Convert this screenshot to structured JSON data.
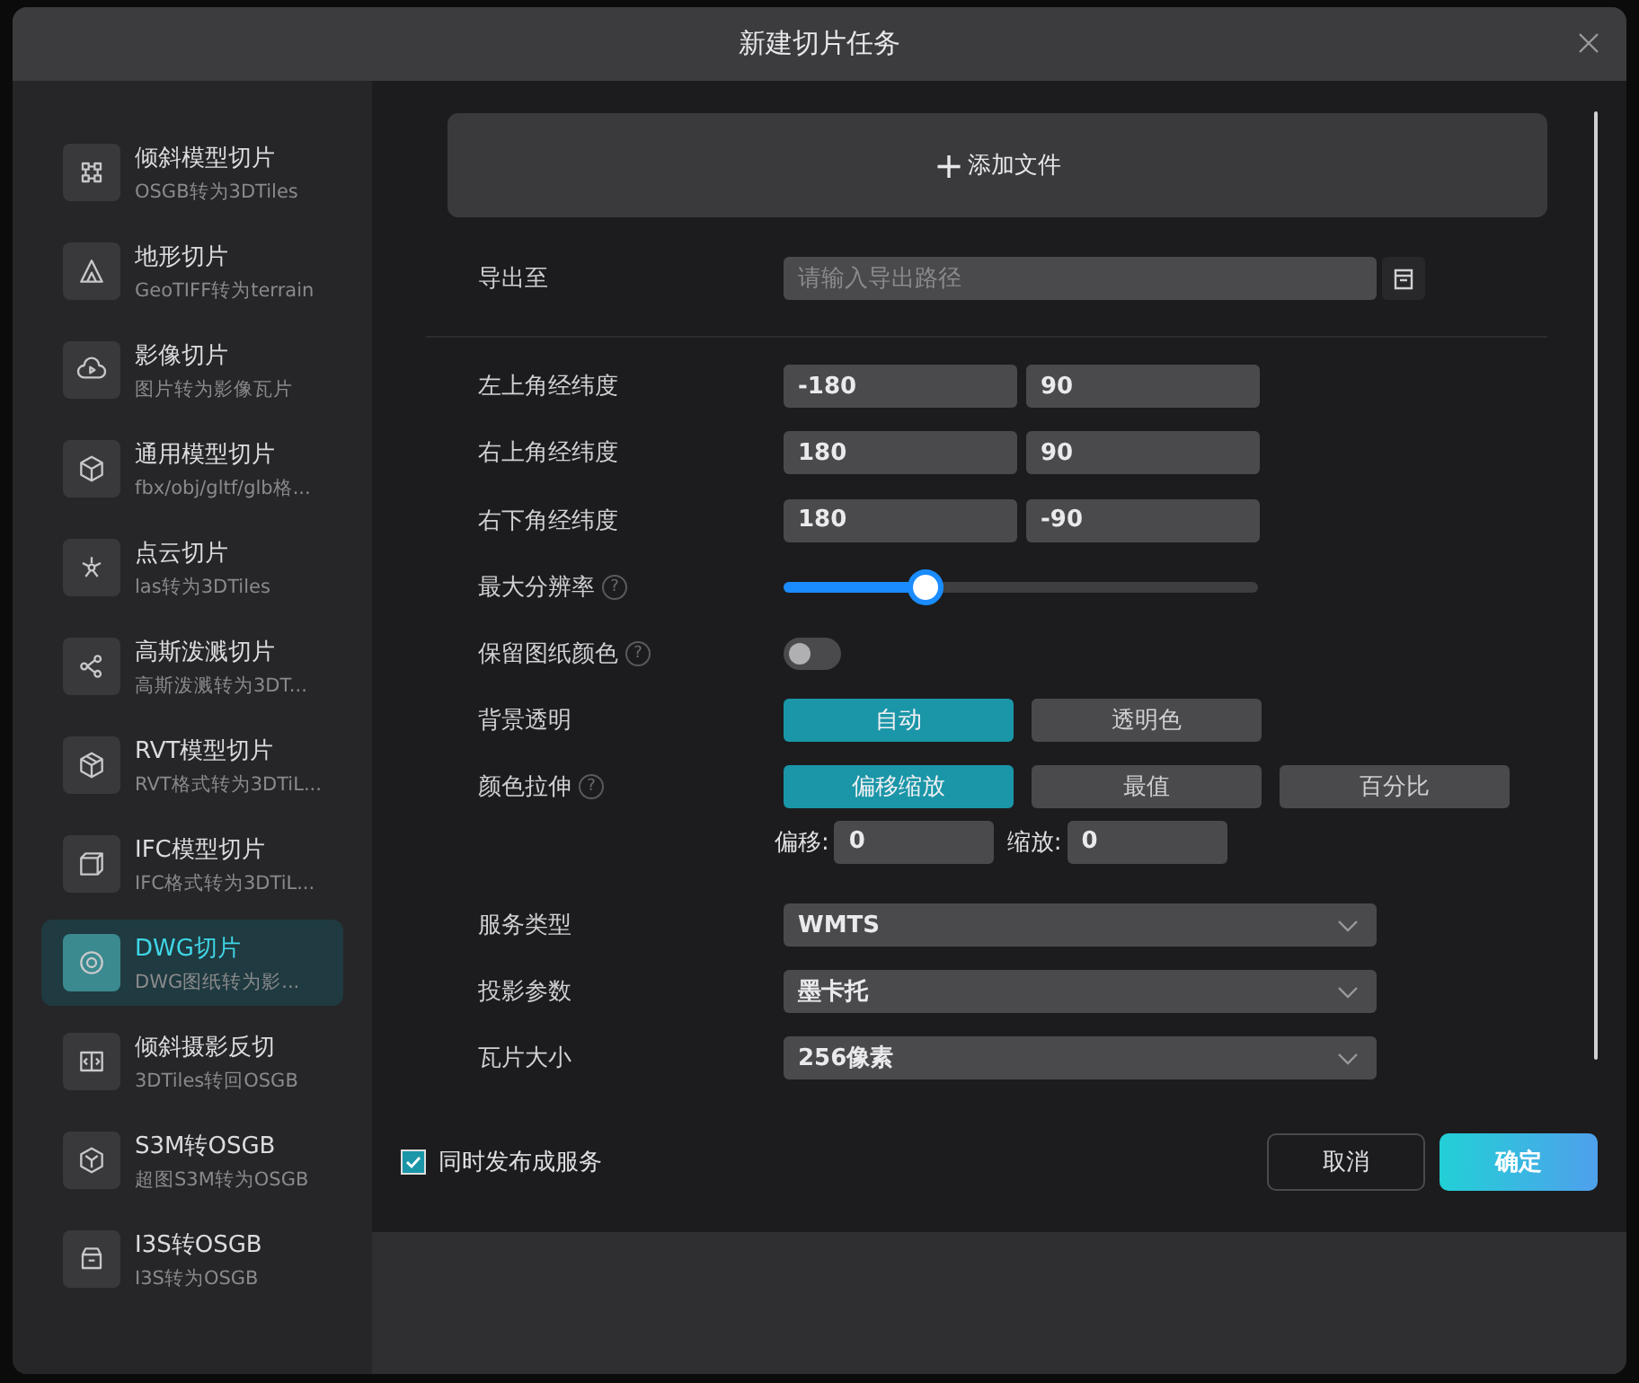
{
  "dialog": {
    "title": "新建切片任务"
  },
  "sidebar": {
    "items": [
      {
        "title": "倾斜模型切片",
        "subtitle": "OSGB转为3DTiles",
        "selected": false
      },
      {
        "title": "地形切片",
        "subtitle": "GeoTIFF转为terrain",
        "selected": false
      },
      {
        "title": "影像切片",
        "subtitle": "图片转为影像瓦片",
        "selected": false
      },
      {
        "title": "通用模型切片",
        "subtitle": "fbx/obj/gltf/glb格...",
        "selected": false
      },
      {
        "title": "点云切片",
        "subtitle": "las转为3DTiles",
        "selected": false
      },
      {
        "title": "高斯泼溅切片",
        "subtitle": "高斯泼溅转为3DT...",
        "selected": false
      },
      {
        "title": "RVT模型切片",
        "subtitle": "RVT格式转为3DTiL...",
        "selected": false
      },
      {
        "title": "IFC模型切片",
        "subtitle": "IFC格式转为3DTiL...",
        "selected": false
      },
      {
        "title": "DWG切片",
        "subtitle": "DWG图纸转为影...",
        "selected": true
      },
      {
        "title": "倾斜摄影反切",
        "subtitle": "3DTiles转回OSGB",
        "selected": false
      },
      {
        "title": "S3M转OSGB",
        "subtitle": "超图S3M转为OSGB",
        "selected": false
      },
      {
        "title": "I3S转OSGB",
        "subtitle": "I3S转为OSGB",
        "selected": false
      }
    ]
  },
  "add_file_button": {
    "icon": "+",
    "label": "添加文件"
  },
  "export": {
    "label": "导出至",
    "placeholder": "请输入导出路径"
  },
  "coordinates": [
    {
      "label": "左上角经纬度",
      "values": [
        "-180",
        "90"
      ]
    },
    {
      "label": "右上角经纬度",
      "values": [
        "180",
        "90"
      ]
    },
    {
      "label": "右下角经纬度",
      "values": [
        "180",
        "-90"
      ]
    }
  ],
  "max_resolution": {
    "label": "最大分辨率",
    "help": "?",
    "level": 0.3
  },
  "keep_colors": {
    "label": "保留图纸颜色",
    "help": "?",
    "on": false
  },
  "background": {
    "label": "背景透明",
    "options": [
      {
        "label": "自动",
        "selected": true
      },
      {
        "label": "透明色",
        "selected": false
      }
    ]
  },
  "stretch": {
    "label": "颜色拉伸",
    "help": "?",
    "options": [
      {
        "label": "偏移缩放",
        "selected": true
      },
      {
        "label": "最值",
        "selected": false
      },
      {
        "label": "百分比",
        "selected": false
      }
    ],
    "params": [
      {
        "label": "偏移:",
        "value": "0"
      },
      {
        "label": "缩放:",
        "value": "0"
      }
    ]
  },
  "selects": [
    {
      "label": "服务类型",
      "value": "WMTS"
    },
    {
      "label": "投影参数",
      "value": "墨卡托"
    },
    {
      "label": "瓦片大小",
      "value": "256像素"
    }
  ],
  "publish": {
    "label": "同时发布成服务",
    "checked": true
  },
  "buttons": {
    "cancel": "取消",
    "confirm": "确定"
  }
}
